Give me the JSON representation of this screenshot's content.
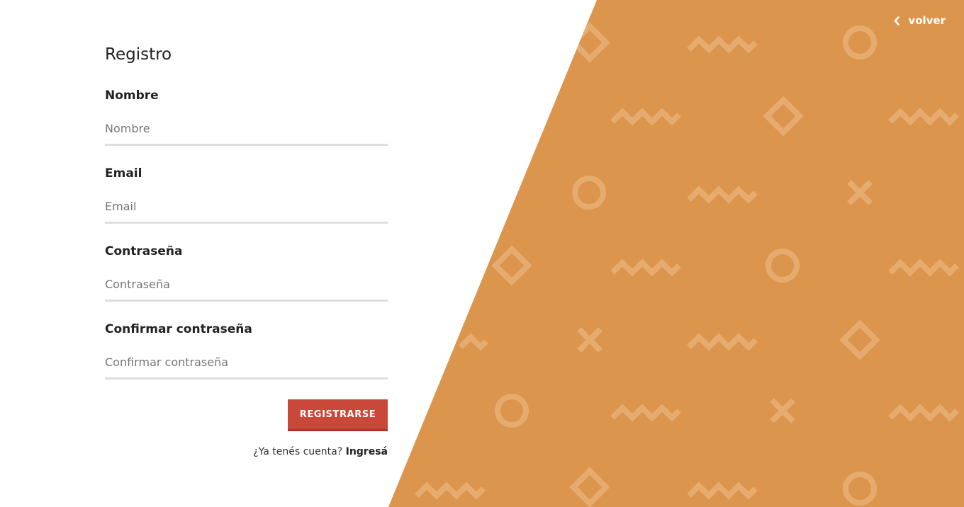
{
  "form": {
    "title": "Registro",
    "fields": [
      {
        "label": "Nombre",
        "placeholder": "Nombre"
      },
      {
        "label": "Email",
        "placeholder": "Email"
      },
      {
        "label": "Contraseña",
        "placeholder": "Contraseña"
      },
      {
        "label": "Confirmar contraseña",
        "placeholder": "Confirmar contraseña"
      }
    ],
    "submit_label": "REGISTRARSE",
    "login_prompt": "¿Ya tenés cuenta?",
    "login_link": "Ingresá"
  },
  "nav": {
    "back_label": "volver"
  },
  "colors": {
    "accent_panel": "#dc954d",
    "pattern": "#e6ac6f",
    "button": "#c9483a",
    "field_border": "#dedede"
  }
}
